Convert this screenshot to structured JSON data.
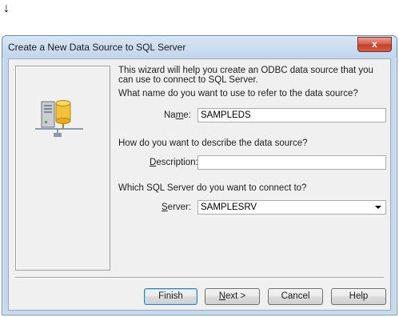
{
  "caption_arrow": "↓",
  "window": {
    "title": "Create a New Data Source to SQL Server",
    "close_glyph": "x"
  },
  "intro_text": "This wizard will help you create an ODBC data source that you can use to connect to SQL Server.",
  "name_question": "What name do you want to use to refer to the data source?",
  "name_label_pre": "Na",
  "name_label_key": "m",
  "name_label_post": "e:",
  "name_value": "SAMPLEDS",
  "description_question": "How do you want to describe the data source?",
  "description_label_key": "D",
  "description_label_post": "escription:",
  "description_value": "",
  "server_question": "Which SQL Server do you want to connect to?",
  "server_label_key": "S",
  "server_label_post": "erver:",
  "server_value": "SAMPLESRV",
  "buttons": {
    "finish": "Finish",
    "next_key": "N",
    "next_post": "ext >",
    "cancel": "Cancel",
    "help": "Help"
  },
  "colors": {
    "title_bar": "#c4d8ee",
    "close_button": "#c2402a",
    "dialog_bg": "#f0f0f0"
  },
  "icons": {
    "close": "close-icon",
    "wizard": "computer-database-icon",
    "dropdown": "chevron-down-icon"
  }
}
